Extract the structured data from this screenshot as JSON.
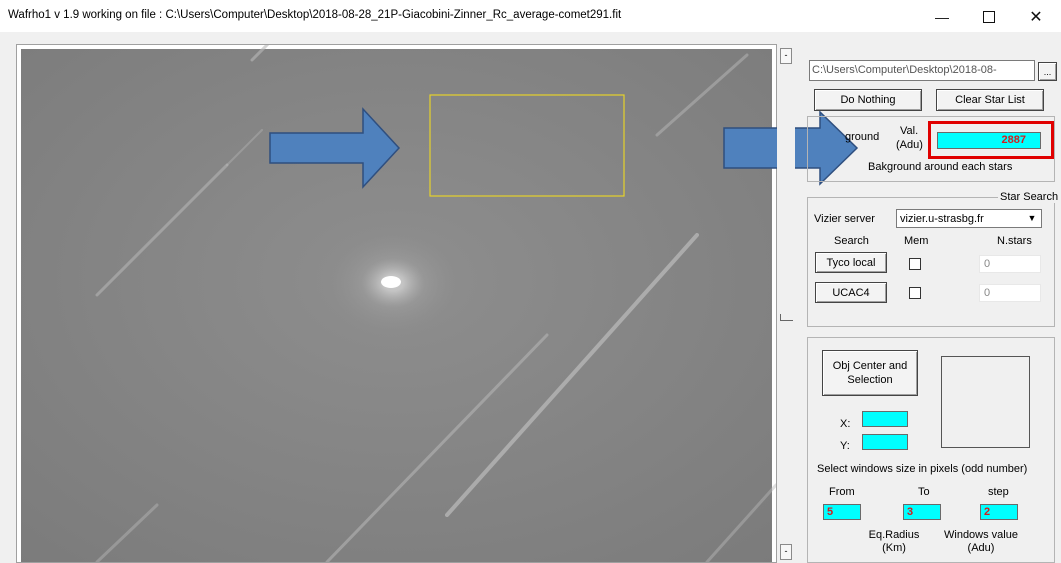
{
  "window": {
    "title": "Wafrho1 v 1.9 working on file : C:\\Users\\Computer\\Desktop\\2018-08-28_21P-Giacobini-Zinner_Rc_average-comet291.fit",
    "minimize_icon": "minimize-icon",
    "maximize_icon": "maximize-icon",
    "close_icon": "close-icon"
  },
  "path_field": {
    "value": "C:\\Users\\Computer\\Desktop\\2018-08-",
    "browse_label": "..."
  },
  "buttons": {
    "do_nothing": "Do Nothing",
    "clear_star_list": "Clear Star List"
  },
  "background": {
    "label": "ground",
    "val_label_1": "Val.",
    "val_label_2": "(Adu)",
    "value": "2887",
    "each_stars_label": "Bakground around each stars"
  },
  "star_search": {
    "group_title": "Star Search",
    "vizier_label": "Vizier server",
    "vizier_value": "vizier.u-strasbg.fr",
    "col_search": "Search",
    "col_mem": "Mem",
    "col_nstars": "N.stars",
    "rows": [
      {
        "button": "Tyco local",
        "count": "0"
      },
      {
        "button": "UCAC4",
        "count": "0"
      }
    ]
  },
  "object": {
    "center_button_line1": "Obj Center and",
    "center_button_line2": "Selection",
    "x_label": "X:",
    "y_label": "Y:",
    "x_value": "",
    "y_value": "",
    "window_size_label": "Select windows size in pixels (odd number)",
    "from_label": "From",
    "to_label": "To",
    "step_label": "step",
    "from_value": "5",
    "to_value": "3",
    "step_value": "2",
    "eq_radius_label_1": "Eq.Radius",
    "eq_radius_label_2": "(Km)",
    "windows_value_label_1": "Windows value",
    "windows_value_label_2": "(Adu)"
  },
  "scrollbar": {
    "up_label": "-",
    "down_label": "-"
  },
  "annotations": {
    "arrow_color": "#4f81bd",
    "selection_rect_color": "#e6d22a",
    "highlight_color": "#e00000"
  }
}
